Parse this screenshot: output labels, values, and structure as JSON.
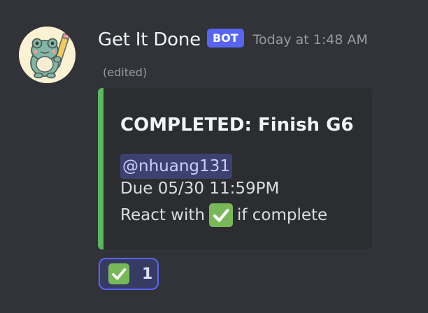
{
  "message": {
    "author": "Get It Done",
    "bot_tag": "BOT",
    "timestamp": "Today at 1:48 AM",
    "edited": "(edited)",
    "avatar_icon": "frog-with-pencil-icon"
  },
  "embed": {
    "accent_color": "#5cb85c",
    "title": "COMPLETED: Finish G6",
    "mention": "@nhuang131",
    "due": "Due 05/30 11:59PM",
    "react_prefix": "React with",
    "react_suffix": "if complete",
    "react_emoji": "check-mark-button-icon"
  },
  "reaction": {
    "emoji": "check-mark-button-icon",
    "count": "1"
  },
  "colors": {
    "background": "#313338",
    "embed_background": "#2b2d31",
    "bot_tag": "#5865f2",
    "mention_background": "#3c4270",
    "reaction_border": "#5865f2"
  }
}
